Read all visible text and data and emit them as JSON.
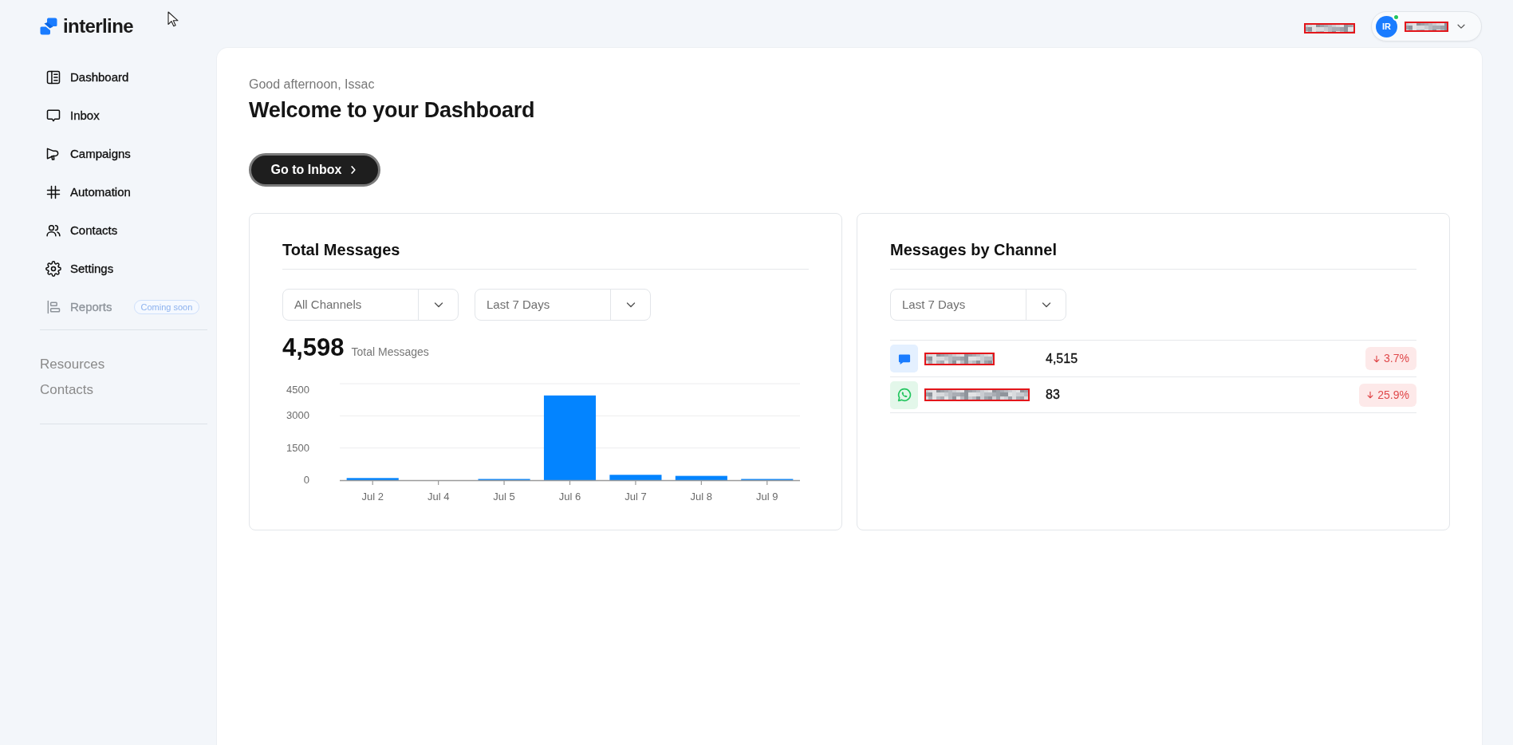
{
  "brand": {
    "name": "interline"
  },
  "top_bar": {
    "user": {
      "initials": "IR",
      "online": true
    }
  },
  "sidebar": {
    "items": [
      {
        "label": "Dashboard",
        "disabled": false
      },
      {
        "label": "Inbox",
        "disabled": false
      },
      {
        "label": "Campaigns",
        "disabled": false
      },
      {
        "label": "Automation",
        "disabled": false
      },
      {
        "label": "Contacts",
        "disabled": false
      },
      {
        "label": "Settings",
        "disabled": false
      },
      {
        "label": "Reports",
        "disabled": true,
        "badge": "Coming soon"
      }
    ],
    "links": [
      "Resources",
      "Contacts"
    ]
  },
  "welcome": {
    "greeting": "Good afternoon, Issac",
    "title": "Welcome to your Dashboard",
    "button": "Go to Inbox"
  },
  "total_messages": {
    "title": "Total Messages",
    "filters": [
      "All Channels",
      "Last 7 Days"
    ],
    "total": "4,598",
    "total_label": "Total Messages",
    "chart_data": {
      "type": "bar",
      "categories": [
        "Jul 2",
        "Jul 4",
        "Jul 5",
        "Jul 6",
        "Jul 7",
        "Jul 8",
        "Jul 9"
      ],
      "values": [
        100,
        0,
        50,
        3950,
        250,
        200,
        50
      ],
      "ylim": [
        0,
        4500
      ],
      "yticks": [
        0,
        1500,
        3000,
        4500
      ]
    }
  },
  "messages_by_channel": {
    "title": "Messages by Channel",
    "filter": "Last 7 Days",
    "channels": [
      {
        "kind": "chat",
        "count": "4,515",
        "decrease": true,
        "change": "3.7%"
      },
      {
        "kind": "whatsapp",
        "count": "83",
        "decrease": true,
        "change": "25.9%"
      }
    ]
  }
}
